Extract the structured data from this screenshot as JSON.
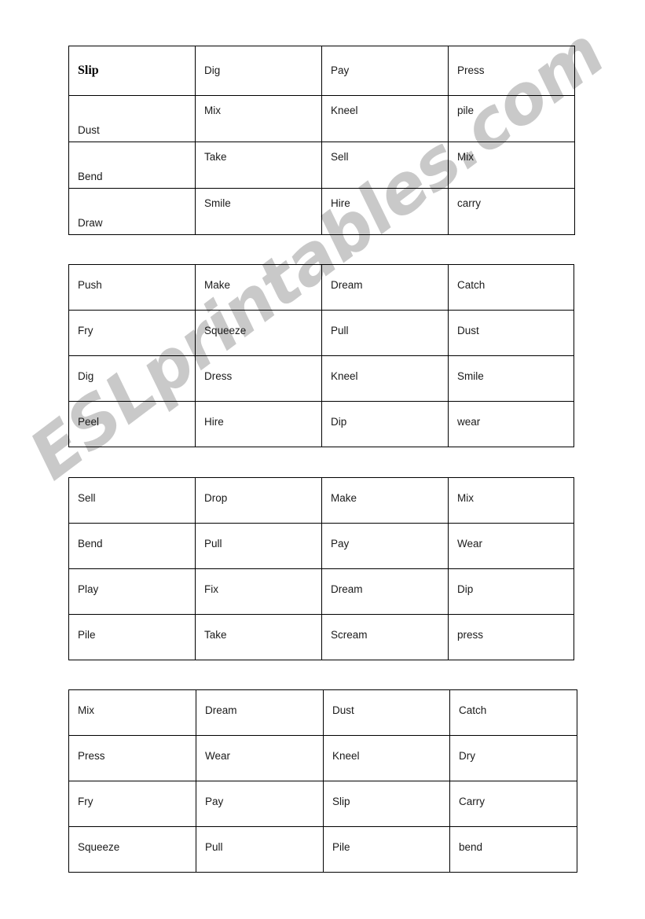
{
  "document": {
    "kind": "worksheet",
    "background_color": "#ffffff",
    "text_color": "#1a1a1a",
    "border_color": "#000000"
  },
  "watermark": {
    "text": "ESLprintables.com",
    "color": "#c9c9c9",
    "rotation_degrees": -37
  },
  "tables": [
    {
      "id": "table-1",
      "rows": [
        [
          "Slip",
          "Dig",
          "Pay",
          "Press"
        ],
        [
          "Dust",
          "Mix",
          "Kneel",
          "pile"
        ],
        [
          "Bend",
          "Take",
          "Sell",
          "Mix"
        ],
        [
          "Draw",
          "Smile",
          "Hire",
          "carry"
        ]
      ]
    },
    {
      "id": "table-2",
      "rows": [
        [
          "Push",
          "Make",
          "Dream",
          "Catch"
        ],
        [
          "Fry",
          "Squeeze",
          "Pull",
          "Dust"
        ],
        [
          "Dig",
          "Dress",
          "Kneel",
          "Smile"
        ],
        [
          "Peel",
          "Hire",
          "Dip",
          "wear"
        ]
      ]
    },
    {
      "id": "table-3",
      "rows": [
        [
          "Sell",
          "Drop",
          "Make",
          "Mix"
        ],
        [
          "Bend",
          "Pull",
          "Pay",
          "Wear"
        ],
        [
          "Play",
          "Fix",
          "Dream",
          "Dip"
        ],
        [
          "Pile",
          "Take",
          "Scream",
          "press"
        ]
      ]
    },
    {
      "id": "table-4",
      "rows": [
        [
          "Mix",
          "Dream",
          "Dust",
          "Catch"
        ],
        [
          "Press",
          "Wear",
          "Kneel",
          "Dry"
        ],
        [
          "Fry",
          "Pay",
          "Slip",
          "Carry"
        ],
        [
          "Squeeze",
          "Pull",
          "Pile",
          "bend"
        ]
      ]
    }
  ]
}
